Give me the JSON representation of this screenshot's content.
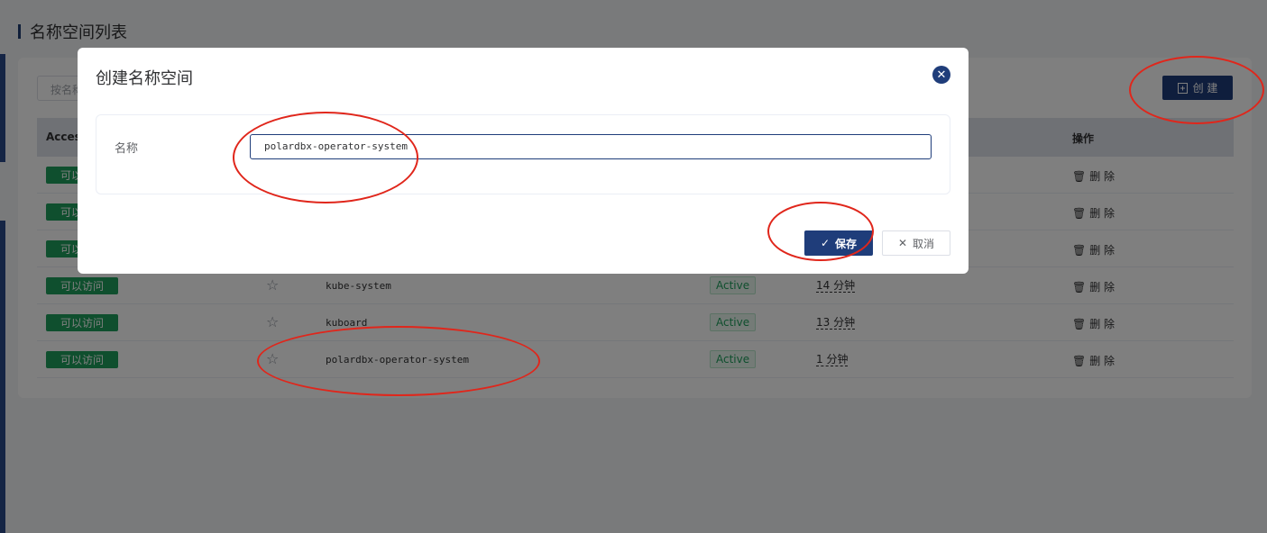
{
  "page": {
    "title": "名称空间列表",
    "search_placeholder": "按名称",
    "create_label": "创 建"
  },
  "table": {
    "headers": {
      "access": "Access",
      "operation": "操作"
    },
    "rows": [
      {
        "access": "可以访问",
        "name": "",
        "status": "",
        "age": "",
        "action": "删 除"
      },
      {
        "access": "可以访问",
        "name": "",
        "status": "",
        "age": "",
        "action": "删 除"
      },
      {
        "access": "可以访问",
        "name": "",
        "status": "",
        "age": "",
        "action": "删 除"
      },
      {
        "access": "可以访问",
        "name": "kube-system",
        "status": "Active",
        "age": "14 分钟",
        "action": "删 除"
      },
      {
        "access": "可以访问",
        "name": "kuboard",
        "status": "Active",
        "age": "13 分钟",
        "action": "删 除"
      },
      {
        "access": "可以访问",
        "name": "polardbx-operator-system",
        "status": "Active",
        "age": "1 分钟",
        "action": "删 除"
      }
    ]
  },
  "dialog": {
    "title": "创建名称空间",
    "name_label": "名称",
    "name_value": "polardbx-operator-system",
    "save_label": "保存",
    "cancel_label": "取消"
  },
  "colors": {
    "primary": "#1f3d7a",
    "success": "#1f9e5c",
    "annotation": "#e0261b"
  }
}
